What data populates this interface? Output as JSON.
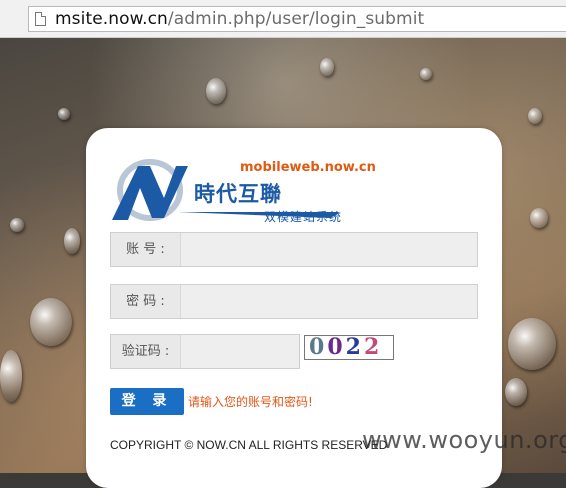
{
  "browser": {
    "url_host": "msite.now.cn",
    "url_path": "/admin.php/user/login_submit"
  },
  "logo": {
    "domain_text": "mobileweb.now.cn",
    "brand_name": "時代互聯",
    "system_name": "双模建站系统",
    "colors": {
      "blue": "#1c5aa6",
      "orange": "#e05a10"
    }
  },
  "form": {
    "account_label": "账 号 :",
    "account_value": "",
    "password_label": "密 码 :",
    "password_value": "",
    "captcha_label": "验证码 :",
    "captcha_value": "",
    "captcha_chars": [
      "0",
      "0",
      "2",
      "2"
    ],
    "captcha_colors": [
      "#5a7a8a",
      "#6b2a8a",
      "#2a3a9a",
      "#c04a7a"
    ],
    "login_button": "登 录",
    "error_message": "请输入您的账号和密码!"
  },
  "footer": {
    "copyright": "COPYRIGHT © NOW.CN ALL RIGHTS RESERVED"
  },
  "watermark": "www.wooyun.org"
}
